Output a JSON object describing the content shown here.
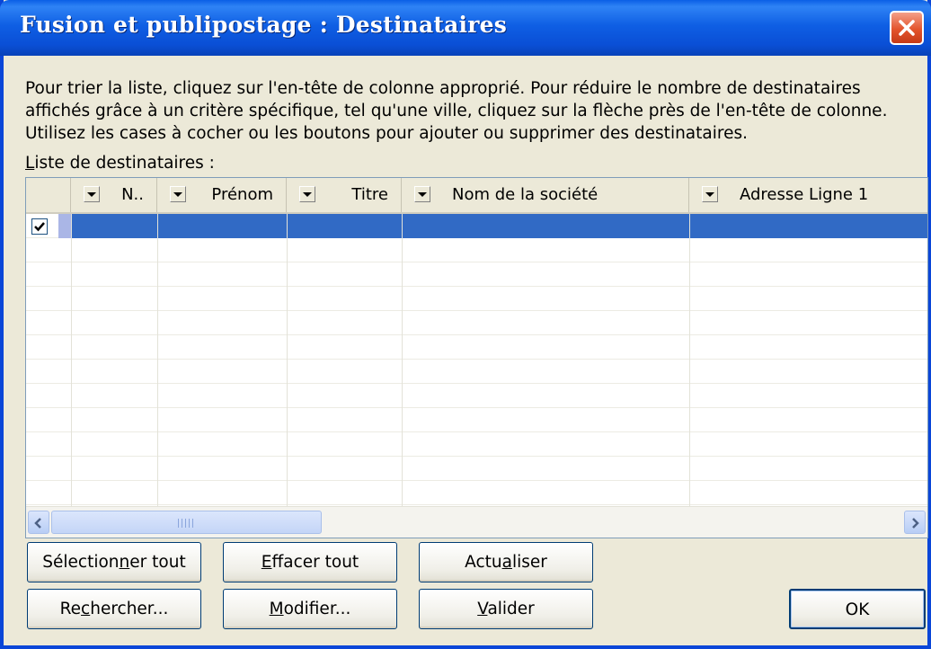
{
  "window": {
    "title": "Fusion et publipostage : Destinataires",
    "close_icon": "close-icon"
  },
  "description": "Pour trier la liste, cliquez sur l'en-tête de colonne approprié. Pour réduire le nombre de destinataires affichés grâce à un critère spécifique, tel qu'une ville, cliquez sur la flèche près de l'en-tête de colonne. Utilisez les cases à cocher ou les boutons pour ajouter ou supprimer des destinataires.",
  "list_label": {
    "mnemonic": "L",
    "rest": "iste de destinataires :"
  },
  "columns": [
    {
      "label": "N.."
    },
    {
      "label": "Prénom"
    },
    {
      "label": "Titre"
    },
    {
      "label": "Nom de la société"
    },
    {
      "label": "Adresse Ligne 1"
    }
  ],
  "rows": [
    {
      "checked": true,
      "selected": true,
      "cells": [
        "",
        "",
        "",
        "",
        ""
      ]
    }
  ],
  "buttons": {
    "select_all": {
      "pre": "Sélection",
      "mn": "n",
      "post": "er tout"
    },
    "clear_all": {
      "pre": "",
      "mn": "E",
      "post": "ffacer tout"
    },
    "refresh": {
      "pre": "Actu",
      "mn": "a",
      "post": "liser"
    },
    "find": {
      "pre": "Re",
      "mn": "c",
      "post": "hercher..."
    },
    "edit": {
      "pre": "",
      "mn": "M",
      "post": "odifier..."
    },
    "validate": {
      "pre": "",
      "mn": "V",
      "post": "alider"
    },
    "ok": "OK"
  },
  "colors": {
    "title_bar": "#0a4fd6",
    "selection": "#316ac5",
    "dialog_bg": "#ece9d8"
  }
}
